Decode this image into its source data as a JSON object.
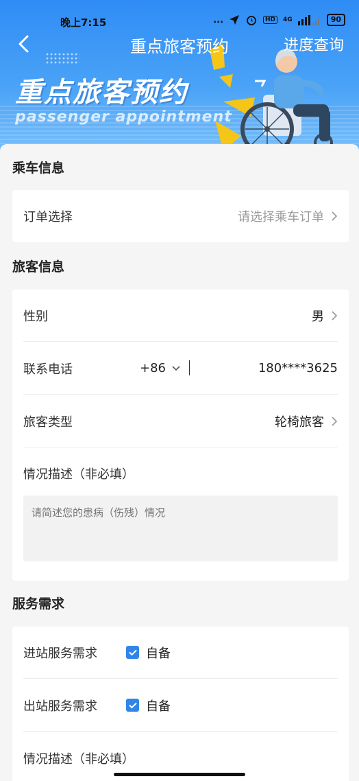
{
  "status_bar": {
    "time": "晚上7:15",
    "dots": "...",
    "network": "4G",
    "hd": "HD",
    "battery": "90"
  },
  "nav": {
    "title": "重点旅客预约",
    "progress_link": "进度查询"
  },
  "hero": {
    "title": "重点旅客预约",
    "subtitle": "passenger appointment"
  },
  "sections": {
    "ride": {
      "title": "乘车信息",
      "order_label": "订单选择",
      "order_placeholder": "请选择乘车订单"
    },
    "passenger": {
      "title": "旅客信息",
      "gender_label": "性别",
      "gender_value": "男",
      "phone_label": "联系电话",
      "phone_code": "+86",
      "phone_value": "180****3625",
      "type_label": "旅客类型",
      "type_value": "轮椅旅客",
      "desc_label": "情况描述（非必填）",
      "desc_placeholder": "请简述您的患病（伤残）情况"
    },
    "service": {
      "title": "服务需求",
      "in_label": "进站服务需求",
      "in_option": "自备",
      "in_checked": true,
      "out_label": "出站服务需求",
      "out_option": "自备",
      "out_checked": true,
      "desc_label": "情况描述（非必填）"
    }
  },
  "colors": {
    "brand_blue": "#2f8cf5",
    "checkbox_blue": "#2f86e8"
  },
  "icons": [
    "back-arrow-icon",
    "chevron-right-icon",
    "chevron-down-icon",
    "checkmark-icon",
    "wheelchair-illustration"
  ]
}
